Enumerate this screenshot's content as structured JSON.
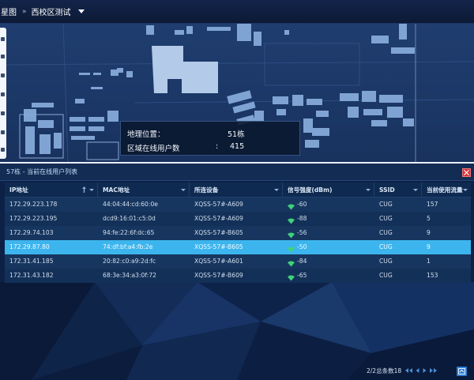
{
  "header": {
    "app_title": "星图",
    "separator": "»",
    "area_name": "西校区测试"
  },
  "map": {
    "tooltip": {
      "location_label": "地理位置：",
      "location_value": "51栋",
      "users_label": "区域在线用户数",
      "users_colon": ":",
      "users_value": "415"
    }
  },
  "panel": {
    "title": "57栋 - 当前在线用户列表",
    "columns": [
      "IP地址",
      "MAC地址",
      "所连设备",
      "信号强度(dBm)",
      "SSID",
      "当前使用流量"
    ],
    "selected_row": 3,
    "rows": [
      {
        "ip": "172.29.223.178",
        "mac": "44:04:44:cd:60:0e",
        "device": "XQSS-57#-A609",
        "signal": "-60",
        "ssid": "CUG",
        "traffic": "157"
      },
      {
        "ip": "172.29.223.195",
        "mac": "dcd9:16:01:c5:0d",
        "device": "XQSS-57#-A609",
        "signal": "-88",
        "ssid": "CUG",
        "traffic": "5"
      },
      {
        "ip": "172.29.74.103",
        "mac": "94:fe:22:6f:dc:65",
        "device": "XQSS-57#-B605",
        "signal": "-56",
        "ssid": "CUG",
        "traffic": "9"
      },
      {
        "ip": "172.29.87.80",
        "mac": "74:df:bf:a4:fb:2e",
        "device": "XQSS-57#-B605",
        "signal": "-50",
        "ssid": "CUG",
        "traffic": "9"
      },
      {
        "ip": "172.31.41.185",
        "mac": "20:82:c0:a9:2d:fc",
        "device": "XQSS-57#-A601",
        "signal": "-84",
        "ssid": "CUG",
        "traffic": "1"
      },
      {
        "ip": "172.31.43.182",
        "mac": "68:3e:34:a3:0f:72",
        "device": "XQSS-57#-B609",
        "signal": "-65",
        "ssid": "CUG",
        "traffic": "153"
      }
    ]
  },
  "pagination": {
    "page_info": "2/2总条数18"
  },
  "icons": {
    "area_dropdown": "caret-down-icon",
    "close": "close-icon",
    "signal": "wifi-signal-icon",
    "sort": "sort-asc-icon",
    "column_menu": "column-dropdown-icon",
    "pager": [
      "first-page-icon",
      "prev-page-icon",
      "next-page-icon",
      "last-page-icon"
    ],
    "export": "export-icon"
  },
  "colors": {
    "selected_row": "#3cb5ee",
    "signal_icon": "#3fd27a",
    "close_button": "#d8333a",
    "building": "#7fa4d4",
    "building_highlight": "#b3cae8"
  }
}
